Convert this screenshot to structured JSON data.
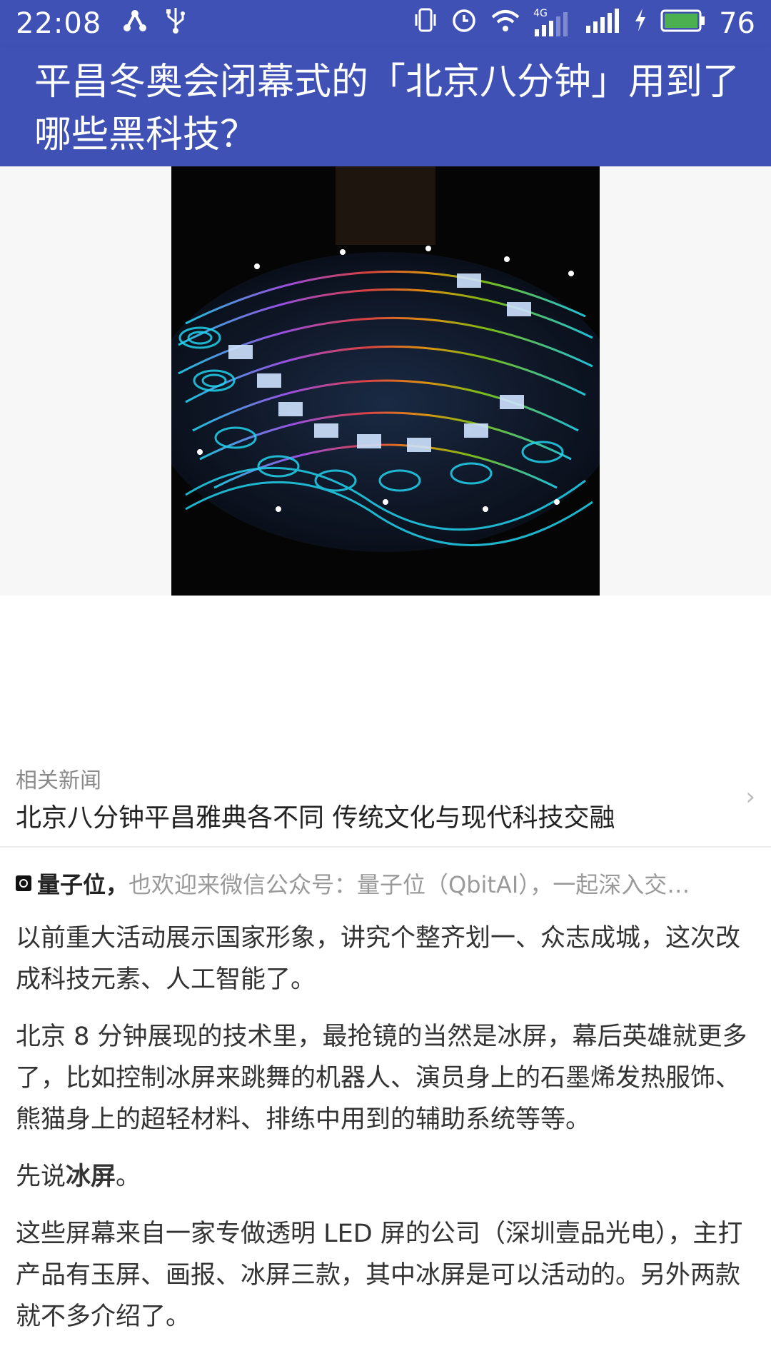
{
  "status_bar": {
    "time": "22:08",
    "left_icons": [
      "share-icon",
      "usb-icon"
    ],
    "right_icons": [
      "vibrate-icon",
      "alarm-icon",
      "wifi-icon",
      "signal-4g-icon",
      "signal-icon",
      "charging-icon",
      "battery-icon"
    ],
    "network_label": "4G",
    "battery_level": "76",
    "colors": {
      "bar": "#3f51b5",
      "battery_fill": "#4caf50"
    }
  },
  "app_bar": {
    "title": "平昌冬奥会闭幕式的「北京八分钟」用到了哪些黑科技？"
  },
  "hero_image": {
    "alt_icon": "light-show-image"
  },
  "related": {
    "label": "相关新闻",
    "title": "北京八分钟平昌雅典各不同 传统文化与现代科技交融"
  },
  "source": {
    "name": "量子位，",
    "rest": "也欢迎来微信公众号：量子位（QbitAI），一起深入交…"
  },
  "article": {
    "p1": "以前重大活动展示国家形象，讲究个整齐划一、众志成城，这次改成科技元素、人工智能了。",
    "p2": "北京 8 分钟展现的技术里，最抢镜的当然是冰屏，幕后英雄就更多了，比如控制冰屏来跳舞的机器人、演员身上的石墨烯发热服饰、熊猫身上的超轻材料、排练中用到的辅助系统等等。",
    "p3_pre": "先说",
    "p3_bold": "冰屏",
    "p3_post": "。",
    "p4": "这些屏幕来自一家专做透明 LED 屏的公司（深圳壹品光电），主打产品有玉屏、画报、冰屏三款，其中冰屏是可以活动的。另外两款就不多介绍了。"
  }
}
